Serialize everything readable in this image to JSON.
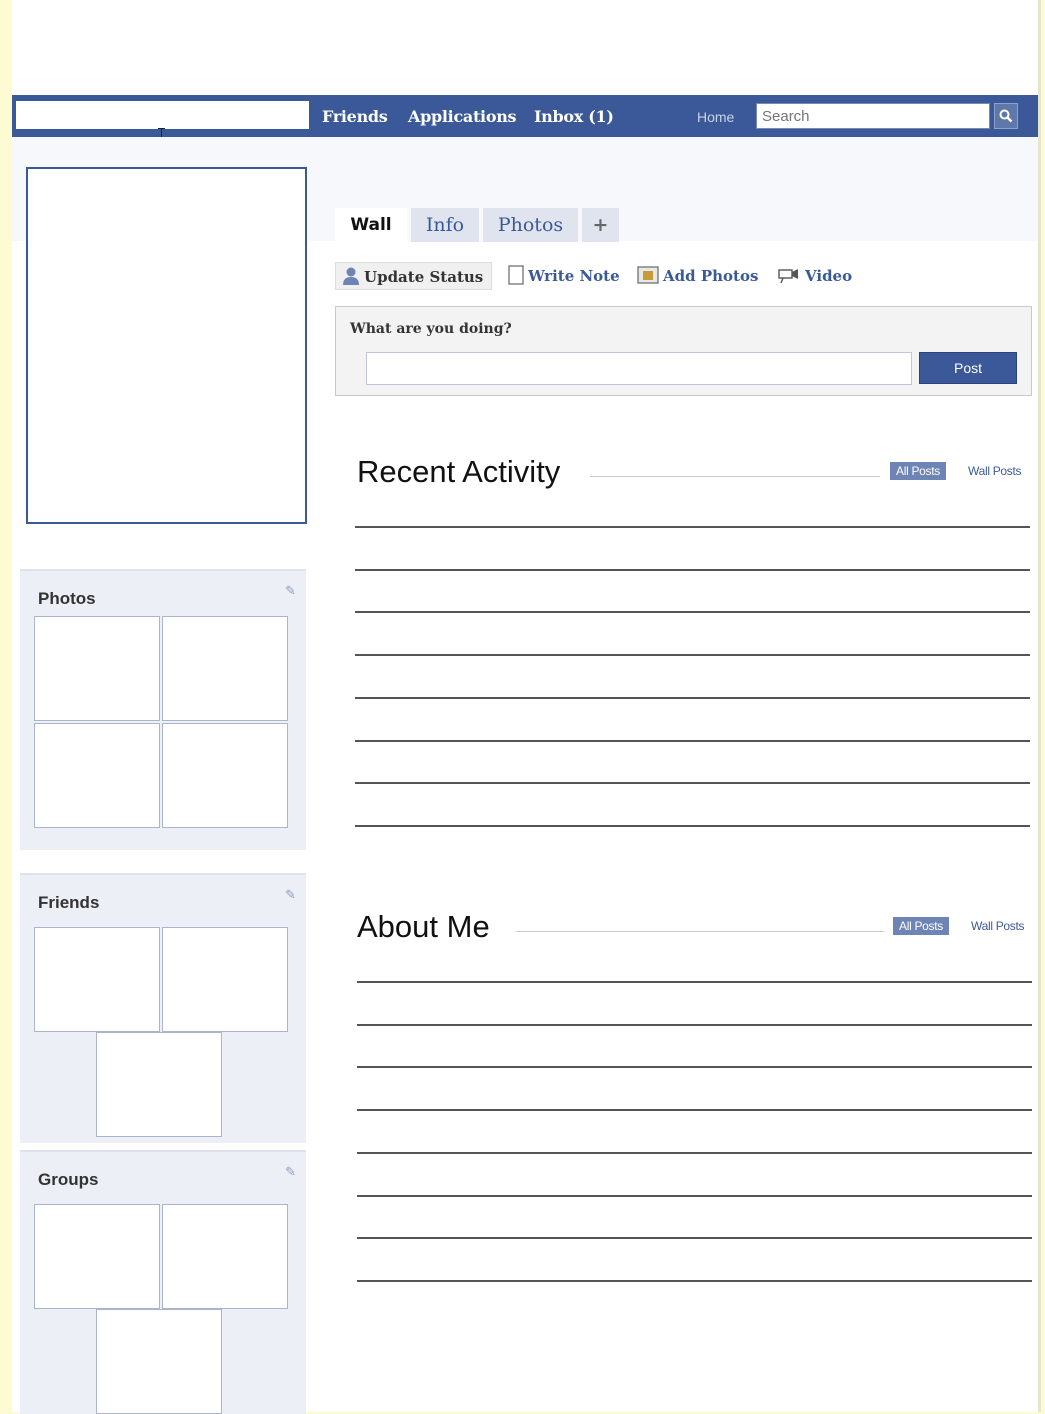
{
  "topbar": {
    "nav": [
      "Friends",
      "Applications",
      "Inbox (1)"
    ],
    "home_label": "Home",
    "search_placeholder": "Search",
    "search_icon": "search-icon",
    "brand_color": "#3b5998"
  },
  "tabs": [
    "Wall",
    "Info",
    "Photos",
    "+"
  ],
  "actions": [
    {
      "label": "Update Status",
      "icon": "person-icon"
    },
    {
      "label": "Write Note",
      "icon": "note-icon"
    },
    {
      "label": "Add Photos",
      "icon": "photo-icon"
    },
    {
      "label": "Video",
      "icon": "video-camera-icon"
    }
  ],
  "composer": {
    "prompt": "What are you doing?",
    "post_label": "Post"
  },
  "sidebar": {
    "photos_title": "Photos",
    "friends_title": "Friends",
    "groups_title": "Groups"
  },
  "recent_activity": {
    "title": "Recent Activity",
    "all_posts": "All Posts",
    "wall_posts": "Wall Posts"
  },
  "about_me": {
    "title": "About Me",
    "all_posts": "All Posts",
    "wall_posts": "Wall Posts"
  }
}
